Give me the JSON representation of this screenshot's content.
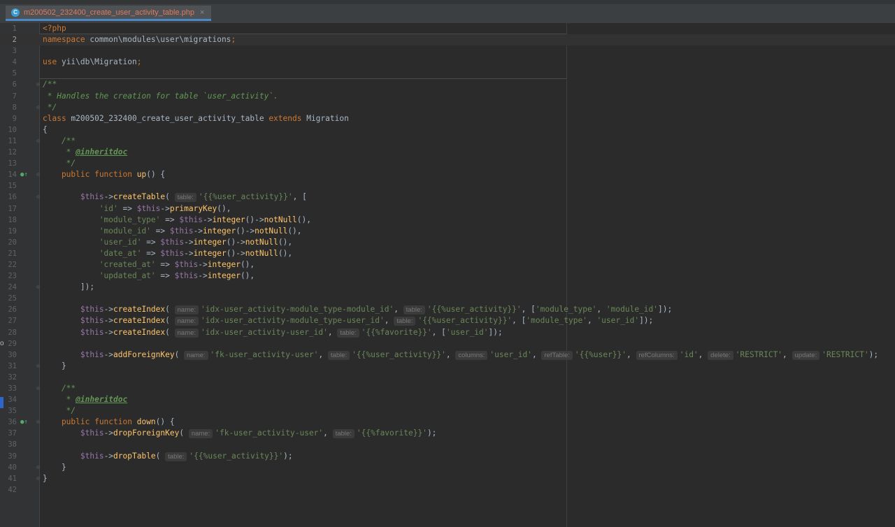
{
  "tab": {
    "icon_letter": "C",
    "filename": "m200502_232400_create_user_activity_table.php",
    "close": "×"
  },
  "gutter": {
    "side_letter": "o"
  },
  "colors": {
    "background": "#2b2b2b",
    "keyword": "#cc7832",
    "string": "#6a8759",
    "variable": "#9876aa",
    "function": "#ffc66d",
    "comment": "#629755",
    "tab_text": "#e07a5f",
    "tab_accent": "#4a88c7"
  },
  "lines": [
    {
      "n": "1",
      "segs": [
        [
          "kw",
          "<?php"
        ]
      ]
    },
    {
      "n": "2",
      "current": true,
      "segs": [
        [
          "kw",
          "namespace "
        ],
        [
          "dflt",
          "common\\modules\\user\\migrations"
        ],
        [
          "kw",
          ";"
        ]
      ]
    },
    {
      "n": "3",
      "segs": []
    },
    {
      "n": "4",
      "segs": [
        [
          "kw",
          "use "
        ],
        [
          "dflt",
          "yii\\db\\Migration"
        ],
        [
          "kw",
          ";"
        ]
      ]
    },
    {
      "n": "5",
      "segs": []
    },
    {
      "n": "6",
      "fold": true,
      "segs": [
        [
          "cmt",
          "/**"
        ]
      ]
    },
    {
      "n": "7",
      "segs": [
        [
          "cmt",
          " * Handles the creation for table `user_activity`."
        ]
      ]
    },
    {
      "n": "8",
      "fold": true,
      "segs": [
        [
          "cmt",
          " */"
        ]
      ]
    },
    {
      "n": "9",
      "segs": [
        [
          "kw",
          "class "
        ],
        [
          "dflt",
          "m200502_232400_create_user_activity_table "
        ],
        [
          "kw",
          "extends "
        ],
        [
          "dflt",
          "Migration"
        ]
      ]
    },
    {
      "n": "10",
      "segs": [
        [
          "dflt",
          "{"
        ]
      ]
    },
    {
      "n": "11",
      "fold": true,
      "segs": [
        [
          "cmt",
          "    /**"
        ]
      ]
    },
    {
      "n": "12",
      "segs": [
        [
          "cmt",
          "     * "
        ],
        [
          "tag",
          "@inheritdoc"
        ]
      ]
    },
    {
      "n": "13",
      "segs": [
        [
          "cmt",
          "     */"
        ]
      ]
    },
    {
      "n": "14",
      "mark": true,
      "fold": true,
      "segs": [
        [
          "kw",
          "    public function "
        ],
        [
          "fn",
          "up"
        ],
        [
          "dflt",
          "() {"
        ]
      ]
    },
    {
      "n": "15",
      "segs": []
    },
    {
      "n": "16",
      "fold": true,
      "segs": [
        [
          "var",
          "        $this"
        ],
        [
          "op",
          "->"
        ],
        [
          "fn",
          "createTable"
        ],
        [
          "dflt",
          "( "
        ],
        [
          "hint",
          "table:"
        ],
        [
          "str",
          "'{{%user_activity}}'"
        ],
        [
          "dflt",
          ", ["
        ]
      ]
    },
    {
      "n": "17",
      "segs": [
        [
          "str",
          "            'id'"
        ],
        [
          "op",
          " => "
        ],
        [
          "var",
          "$this"
        ],
        [
          "op",
          "->"
        ],
        [
          "fn",
          "primaryKey"
        ],
        [
          "dflt",
          "(),"
        ]
      ]
    },
    {
      "n": "18",
      "segs": [
        [
          "str",
          "            'module_type'"
        ],
        [
          "op",
          " => "
        ],
        [
          "var",
          "$this"
        ],
        [
          "op",
          "->"
        ],
        [
          "fn",
          "integer"
        ],
        [
          "dflt",
          "()->"
        ],
        [
          "fn",
          "notNull"
        ],
        [
          "dflt",
          "(),"
        ]
      ]
    },
    {
      "n": "19",
      "segs": [
        [
          "str",
          "            'module_id'"
        ],
        [
          "op",
          " => "
        ],
        [
          "var",
          "$this"
        ],
        [
          "op",
          "->"
        ],
        [
          "fn",
          "integer"
        ],
        [
          "dflt",
          "()->"
        ],
        [
          "fn",
          "notNull"
        ],
        [
          "dflt",
          "(),"
        ]
      ]
    },
    {
      "n": "20",
      "segs": [
        [
          "str",
          "            'user_id'"
        ],
        [
          "op",
          " => "
        ],
        [
          "var",
          "$this"
        ],
        [
          "op",
          "->"
        ],
        [
          "fn",
          "integer"
        ],
        [
          "dflt",
          "()->"
        ],
        [
          "fn",
          "notNull"
        ],
        [
          "dflt",
          "(),"
        ]
      ]
    },
    {
      "n": "21",
      "segs": [
        [
          "str",
          "            'date_at'"
        ],
        [
          "op",
          " => "
        ],
        [
          "var",
          "$this"
        ],
        [
          "op",
          "->"
        ],
        [
          "fn",
          "integer"
        ],
        [
          "dflt",
          "()->"
        ],
        [
          "fn",
          "notNull"
        ],
        [
          "dflt",
          "(),"
        ]
      ]
    },
    {
      "n": "22",
      "segs": [
        [
          "str",
          "            'created_at'"
        ],
        [
          "op",
          " => "
        ],
        [
          "var",
          "$this"
        ],
        [
          "op",
          "->"
        ],
        [
          "fn",
          "integer"
        ],
        [
          "dflt",
          "(),"
        ]
      ]
    },
    {
      "n": "23",
      "segs": [
        [
          "str",
          "            'updated_at'"
        ],
        [
          "op",
          " => "
        ],
        [
          "var",
          "$this"
        ],
        [
          "op",
          "->"
        ],
        [
          "fn",
          "integer"
        ],
        [
          "dflt",
          "(),"
        ]
      ]
    },
    {
      "n": "24",
      "fold": true,
      "segs": [
        [
          "dflt",
          "        ]);"
        ]
      ]
    },
    {
      "n": "25",
      "segs": []
    },
    {
      "n": "26",
      "segs": [
        [
          "var",
          "        $this"
        ],
        [
          "op",
          "->"
        ],
        [
          "fn",
          "createIndex"
        ],
        [
          "dflt",
          "( "
        ],
        [
          "hint",
          "name:"
        ],
        [
          "str",
          "'idx-user_activity-module_type-module_id'"
        ],
        [
          "dflt",
          ", "
        ],
        [
          "hint",
          "table:"
        ],
        [
          "str",
          "'{{%user_activity}}'"
        ],
        [
          "dflt",
          ", ["
        ],
        [
          "str",
          "'module_type'"
        ],
        [
          "dflt",
          ", "
        ],
        [
          "str",
          "'module_id'"
        ],
        [
          "dflt",
          "]);"
        ]
      ]
    },
    {
      "n": "27",
      "segs": [
        [
          "var",
          "        $this"
        ],
        [
          "op",
          "->"
        ],
        [
          "fn",
          "createIndex"
        ],
        [
          "dflt",
          "( "
        ],
        [
          "hint",
          "name:"
        ],
        [
          "str",
          "'idx-user_activity-module_type-user_id'"
        ],
        [
          "dflt",
          ", "
        ],
        [
          "hint",
          "table:"
        ],
        [
          "str",
          "'{{%user_activity}}'"
        ],
        [
          "dflt",
          ", ["
        ],
        [
          "str",
          "'module_type'"
        ],
        [
          "dflt",
          ", "
        ],
        [
          "str",
          "'user_id'"
        ],
        [
          "dflt",
          "]);"
        ]
      ]
    },
    {
      "n": "28",
      "segs": [
        [
          "var",
          "        $this"
        ],
        [
          "op",
          "->"
        ],
        [
          "fn",
          "createIndex"
        ],
        [
          "dflt",
          "( "
        ],
        [
          "hint",
          "name:"
        ],
        [
          "str",
          "'idx-user_activity-user_id'"
        ],
        [
          "dflt",
          ", "
        ],
        [
          "hint",
          "table:"
        ],
        [
          "str",
          "'{{%favorite}}'"
        ],
        [
          "dflt",
          ", ["
        ],
        [
          "str",
          "'user_id'"
        ],
        [
          "dflt",
          "]);"
        ]
      ]
    },
    {
      "n": "29",
      "segs": []
    },
    {
      "n": "30",
      "segs": [
        [
          "var",
          "        $this"
        ],
        [
          "op",
          "->"
        ],
        [
          "fn",
          "addForeignKey"
        ],
        [
          "dflt",
          "( "
        ],
        [
          "hint",
          "name:"
        ],
        [
          "str",
          "'fk-user_activity-user'"
        ],
        [
          "dflt",
          ", "
        ],
        [
          "hint",
          "table:"
        ],
        [
          "str",
          "'{{%user_activity}}'"
        ],
        [
          "dflt",
          ", "
        ],
        [
          "hint",
          "columns:"
        ],
        [
          "str",
          "'user_id'"
        ],
        [
          "dflt",
          ", "
        ],
        [
          "hint",
          "refTable:"
        ],
        [
          "str",
          "'{{%user}}'"
        ],
        [
          "dflt",
          ", "
        ],
        [
          "hint",
          "refColumns:"
        ],
        [
          "str",
          "'id'"
        ],
        [
          "dflt",
          ", "
        ],
        [
          "hint",
          "delete:"
        ],
        [
          "str",
          "'RESTRICT'"
        ],
        [
          "dflt",
          ", "
        ],
        [
          "hint",
          "update:"
        ],
        [
          "str",
          "'RESTRICT'"
        ],
        [
          "dflt",
          ");"
        ]
      ]
    },
    {
      "n": "31",
      "fold": true,
      "segs": [
        [
          "dflt",
          "    }"
        ]
      ]
    },
    {
      "n": "32",
      "segs": []
    },
    {
      "n": "33",
      "fold": true,
      "segs": [
        [
          "cmt",
          "    /**"
        ]
      ]
    },
    {
      "n": "34",
      "segs": [
        [
          "cmt",
          "     * "
        ],
        [
          "tag",
          "@inheritdoc"
        ]
      ]
    },
    {
      "n": "35",
      "segs": [
        [
          "cmt",
          "     */"
        ]
      ]
    },
    {
      "n": "36",
      "mark": true,
      "fold": true,
      "segs": [
        [
          "kw",
          "    public function "
        ],
        [
          "fn",
          "down"
        ],
        [
          "dflt",
          "() {"
        ]
      ]
    },
    {
      "n": "37",
      "segs": [
        [
          "var",
          "        $this"
        ],
        [
          "op",
          "->"
        ],
        [
          "fn",
          "dropForeignKey"
        ],
        [
          "dflt",
          "( "
        ],
        [
          "hint",
          "name:"
        ],
        [
          "str",
          "'fk-user_activity-user'"
        ],
        [
          "dflt",
          ", "
        ],
        [
          "hint",
          "table:"
        ],
        [
          "str",
          "'{{%favorite}}'"
        ],
        [
          "dflt",
          ");"
        ]
      ]
    },
    {
      "n": "38",
      "segs": []
    },
    {
      "n": "39",
      "segs": [
        [
          "var",
          "        $this"
        ],
        [
          "op",
          "->"
        ],
        [
          "fn",
          "dropTable"
        ],
        [
          "dflt",
          "( "
        ],
        [
          "hint",
          "table:"
        ],
        [
          "str",
          "'{{%user_activity}}'"
        ],
        [
          "dflt",
          ");"
        ]
      ]
    },
    {
      "n": "40",
      "fold": true,
      "segs": [
        [
          "dflt",
          "    }"
        ]
      ]
    },
    {
      "n": "41",
      "fold": true,
      "segs": [
        [
          "dflt",
          "}"
        ]
      ]
    },
    {
      "n": "42",
      "segs": []
    }
  ]
}
